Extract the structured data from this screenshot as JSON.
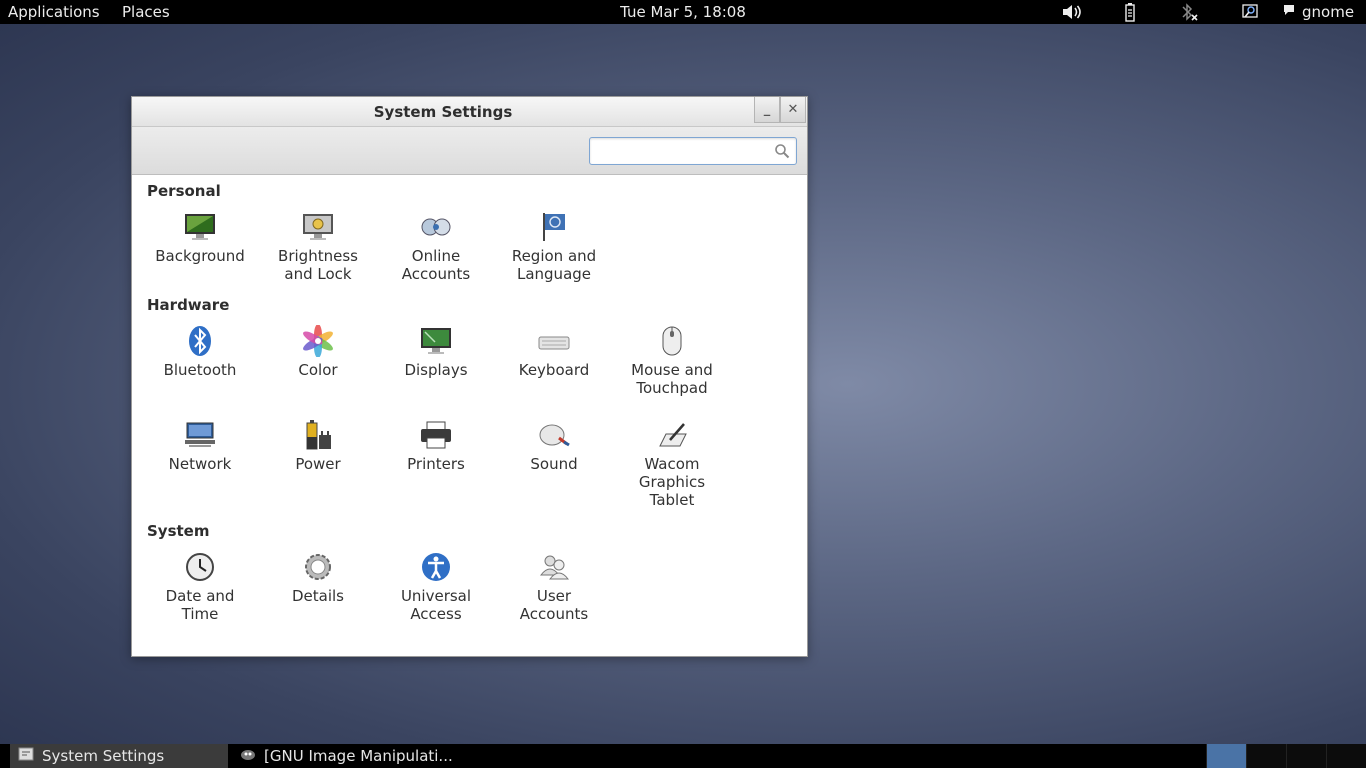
{
  "topbar": {
    "applications": "Applications",
    "places": "Places",
    "clock": "Tue Mar  5, 18:08",
    "user": "gnome",
    "tray": [
      "volume-icon",
      "battery-icon",
      "bluetooth-disabled-icon",
      "accessibility-icon"
    ]
  },
  "window": {
    "title": "System Settings",
    "minimize": "_",
    "close": "✕",
    "search_placeholder": ""
  },
  "sections": [
    {
      "title": "Personal",
      "items": [
        {
          "label1": "Background",
          "label2": "",
          "icon": "background-icon"
        },
        {
          "label1": "Brightness",
          "label2": "and Lock",
          "icon": "brightness-lock-icon"
        },
        {
          "label1": "Online",
          "label2": "Accounts",
          "icon": "online-accounts-icon"
        },
        {
          "label1": "Region and",
          "label2": "Language",
          "icon": "region-flag-icon"
        }
      ]
    },
    {
      "title": "Hardware",
      "items": [
        {
          "label1": "Bluetooth",
          "label2": "",
          "icon": "bluetooth-icon"
        },
        {
          "label1": "Color",
          "label2": "",
          "icon": "color-icon"
        },
        {
          "label1": "Displays",
          "label2": "",
          "icon": "displays-icon"
        },
        {
          "label1": "Keyboard",
          "label2": "",
          "icon": "keyboard-icon"
        },
        {
          "label1": "Mouse and",
          "label2": "Touchpad",
          "icon": "mouse-icon"
        },
        {
          "label1": "Network",
          "label2": "",
          "icon": "network-icon"
        },
        {
          "label1": "Power",
          "label2": "",
          "icon": "power-icon"
        },
        {
          "label1": "Printers",
          "label2": "",
          "icon": "printer-icon"
        },
        {
          "label1": "Sound",
          "label2": "",
          "icon": "sound-icon"
        },
        {
          "label1": "Wacom",
          "label2": "Graphics",
          "label3": "Tablet",
          "icon": "wacom-icon"
        }
      ]
    },
    {
      "title": "System",
      "items": [
        {
          "label1": "Date and",
          "label2": "Time",
          "icon": "clock-icon"
        },
        {
          "label1": "Details",
          "label2": "",
          "icon": "gear-icon"
        },
        {
          "label1": "Universal",
          "label2": "Access",
          "icon": "universal-access-icon"
        },
        {
          "label1": "User",
          "label2": "Accounts",
          "icon": "user-accounts-icon"
        }
      ]
    }
  ],
  "taskbar": {
    "task1": "System Settings",
    "task2": "[GNU Image Manipulati...",
    "workspaces": 4,
    "current_workspace": 1
  }
}
